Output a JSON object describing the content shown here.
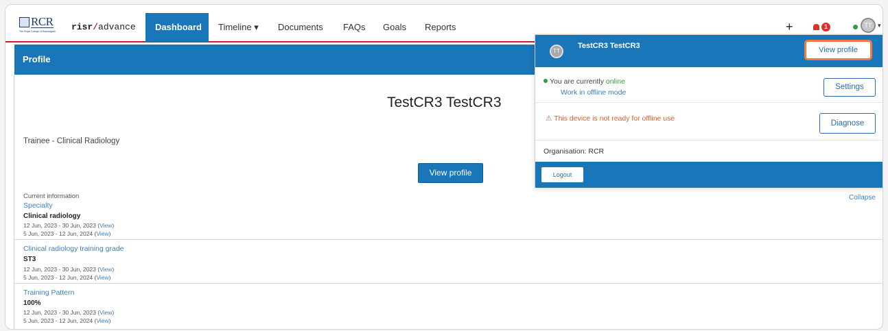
{
  "header": {
    "logo_text": "RCR",
    "logo_subtext": "The Royal College of Radiologists",
    "brand_prefix": "risr",
    "brand_slash": "/",
    "brand_suffix": "advance",
    "nav": [
      {
        "label": "Dashboard"
      },
      {
        "label": "Timeline ▾"
      },
      {
        "label": "Documents"
      },
      {
        "label": "FAQs"
      },
      {
        "label": "Goals"
      },
      {
        "label": "Reports"
      }
    ],
    "plus_label": "+",
    "notification_count": "1",
    "avatar_initials": "TT",
    "caret": "▾"
  },
  "profile": {
    "band_title": "Profile",
    "name": "TestCR3 TestCR3",
    "role": "Trainee - Clinical Radiology",
    "view_profile_label": "View profile",
    "collapse_label": "Collapse",
    "current_info_label": "Current information",
    "sections": [
      {
        "title": "Specialty",
        "value": "Clinical radiology",
        "dates": [
          {
            "text": "12 Jun, 2023 - 30 Jun, 2023 (",
            "link": "View",
            "end": ")"
          },
          {
            "text": "5 Jun, 2023 - 12 Jun, 2024 (",
            "link": "View",
            "end": ")"
          }
        ]
      },
      {
        "title": "Clinical radiology training grade",
        "value": "ST3",
        "dates": [
          {
            "text": "12 Jun, 2023 - 30 Jun, 2023 (",
            "link": "View",
            "end": ")"
          },
          {
            "text": "5 Jun, 2023 - 12 Jun, 2024 (",
            "link": "View",
            "end": ")"
          }
        ]
      },
      {
        "title": "Training Pattern",
        "value": "100%",
        "dates": [
          {
            "text": "12 Jun, 2023 - 30 Jun, 2023 (",
            "link": "View",
            "end": ")"
          },
          {
            "text": "5 Jun, 2023 - 12 Jun, 2024 (",
            "link": "View",
            "end": ")"
          }
        ]
      }
    ]
  },
  "dropdown": {
    "avatar_initials": "TT",
    "user_name": "TestCR3 TestCR3",
    "view_profile_label": "View profile",
    "status_prefix": "You are currently ",
    "status_value": "online",
    "offline_mode_label": "Work in offline mode",
    "settings_label": "Settings",
    "warning_icon": "⚠",
    "warning_text": "This device is not ready for offline use",
    "diagnose_label": "Diagnose",
    "organisation": "Organisation: RCR",
    "logout_label": "Logout"
  },
  "colors": {
    "primary": "#1976b8",
    "accent_red": "#c8202b",
    "online_green": "#2e9e3e",
    "warning_orange": "#e05a2b",
    "highlight_outline": "#f07a3d"
  }
}
